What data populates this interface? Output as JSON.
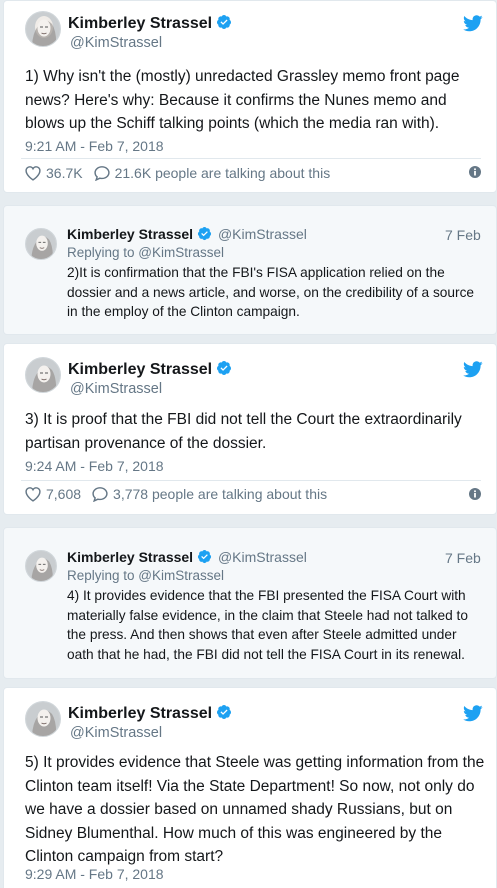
{
  "tweet1": {
    "name": "Kimberley Strassel",
    "handle": "@KimStrassel",
    "text": "1) Why isn't the (mostly) unredacted Grassley memo front page news? Here's why: Because it confirms the Nunes memo and blows up the Schiff talking points (which the media ran with).",
    "timestamp": "9:21 AM - Feb 7, 2018",
    "likes": "36.7K",
    "talking": "21.6K people are talking about this"
  },
  "reply1": {
    "name": "Kimberley Strassel",
    "handle": "@KimStrassel",
    "date": "7 Feb",
    "replying": "Replying to @KimStrassel",
    "text": "2)It is confirmation that the FBI's FISA application relied on the dossier and a news article, and worse, on the credibility of a source in the employ of the Clinton campaign."
  },
  "tweet2": {
    "name": "Kimberley Strassel",
    "handle": "@KimStrassel",
    "text": "3) It is proof that the FBI did not tell the Court the extraordinarily partisan provenance of the dossier.",
    "timestamp": "9:24 AM - Feb 7, 2018",
    "likes": "7,608",
    "talking": "3,778 people are talking about this"
  },
  "reply2": {
    "name": "Kimberley Strassel",
    "handle": "@KimStrassel",
    "date": "7 Feb",
    "replying": "Replying to @KimStrassel",
    "text": "4) It provides evidence that the FBI presented the FISA Court with materially false evidence, in the claim that Steele had not talked to the press. And then shows that even after Steele admitted under oath that he had, the FBI did not tell the FISA Court in its renewal."
  },
  "tweet3": {
    "name": "Kimberley Strassel",
    "handle": "@KimStrassel",
    "text": "5) It provides evidence that Steele was getting information from the Clinton team itself! Via the State Department! So now, not only do we have a dossier based on unnamed shady Russians, but on Sidney Blumenthal. How much of this was engineered by the Clinton campaign from start?",
    "timestamp": "9:29 AM - Feb 7, 2018"
  },
  "icons": {
    "verified": "verified-badge-icon",
    "bird": "twitter-bird-icon",
    "heart": "heart-icon",
    "comment": "comment-bubble-icon",
    "info": "info-icon"
  },
  "colors": {
    "twitter_blue": "#1da1f2",
    "meta_gray": "#657786",
    "text": "#14171a",
    "background": "#e6ecf0"
  }
}
